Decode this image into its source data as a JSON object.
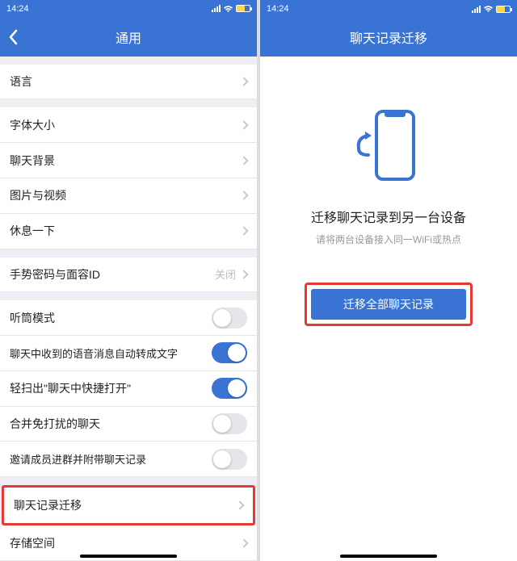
{
  "left": {
    "time": "14:24",
    "title": "通用",
    "rows": {
      "language": "语言",
      "font_size": "字体大小",
      "chat_background": "聊天背景",
      "image_video": "图片与视频",
      "rest": "休息一下",
      "gesture_face": "手势密码与面容ID",
      "gesture_face_value": "关闭",
      "receiver_mode": "听筒模式",
      "auto_transcribe": "聊天中收到的语音消息自动转成文字",
      "quick_open": "轻扫出\"聊天中快捷打开\"",
      "merge_dnd": "合并免打扰的聊天",
      "invite_with_history": "邀请成员进群并附带聊天记录",
      "chat_migration": "聊天记录迁移",
      "storage": "存储空间"
    }
  },
  "right": {
    "time": "14:24",
    "title": "聊天记录迁移",
    "heading": "迁移聊天记录到另一台设备",
    "subtitle": "请将两台设备接入同一WiFi或热点",
    "button": "迁移全部聊天记录"
  }
}
